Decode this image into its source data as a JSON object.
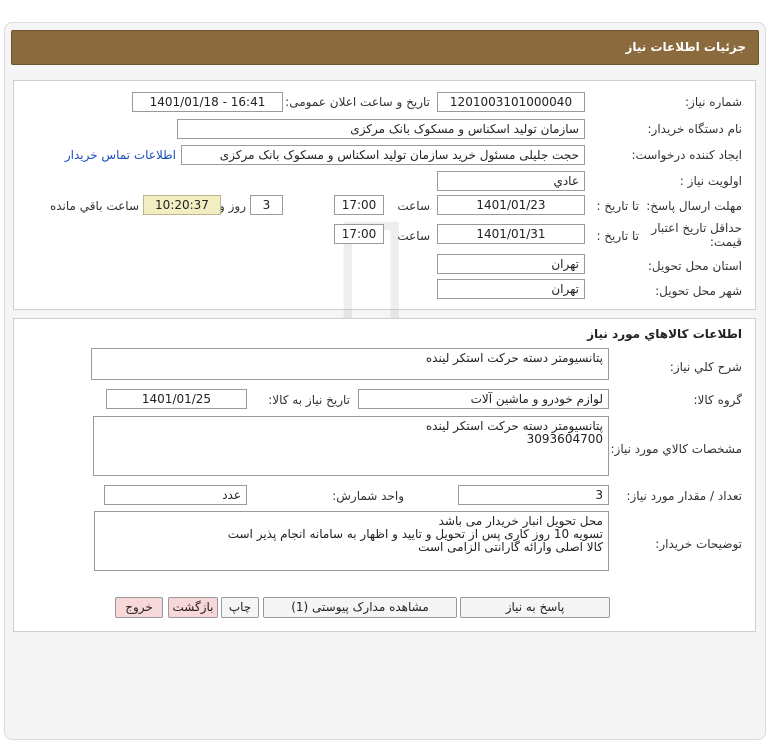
{
  "header": {
    "title": "جزئیات اطلاعات نیاز"
  },
  "need_info": {
    "need_number_label": "شماره نیاز:",
    "need_number": "1201003101000040",
    "announce_label": "تاریخ و ساعت اعلان عمومی:",
    "announce_value": "1401/01/18 - 16:41",
    "buyer_org_label": "نام دستگاه خریدار:",
    "buyer_org": "سازمان تولید اسکناس و مسکوک بانک مرکزی",
    "requester_label": "ایجاد کننده درخواست:",
    "requester": "حجت جلیلی مسئول خرید سازمان تولید اسکناس و مسکوک بانک مرکزی",
    "contact_link": "اطلاعات تماس خریدار",
    "priority_label": "اولویت نیاز :",
    "priority": "عادي",
    "reply_deadline_label": "مهلت ارسال پاسخ:",
    "to_date_label": "تا تاریخ :",
    "reply_date": "1401/01/23",
    "time_label": "ساعت",
    "reply_time": "17:00",
    "days_value": "3",
    "days_label": "روز و",
    "remaining_time": "10:20:37",
    "remaining_label": "ساعت باقي مانده",
    "validity_label_1": "حداقل تاریخ اعتبار",
    "validity_label_2": "قیمت:",
    "validity_to_label": "تا تاریخ :",
    "validity_date": "1401/01/31",
    "validity_time_label": "ساعت",
    "validity_time": "17:00",
    "province_label": "استان محل تحویل:",
    "province": "تهران",
    "city_label": "شهر محل تحویل:",
    "city": "تهران"
  },
  "goods": {
    "section_title": "اطلاعات کالاهاي مورد نياز",
    "summary_label": "شرح کلي نياز:",
    "summary": "پتانسیومتر دسته حرکت استکر لینده",
    "group_label": "گروه کالا:",
    "group": "لوازم خودرو و ماشین آلات",
    "need_date_label": "تاریخ نیاز به کالا:",
    "need_date": "1401/01/25",
    "spec_label": "مشخصات کالاي مورد نياز:",
    "spec_line1": "پتانسیومتر دسته حرکت استکر لینده",
    "spec_line2": "3093604700",
    "qty_label": "تعداد / مقدار مورد نیاز:",
    "qty": "3",
    "unit_label": "واحد شمارش:",
    "unit": "عدد",
    "desc_label": "توضیحات خریدار:",
    "desc_line1": "محل تحویل انبار خریدار می باشد",
    "desc_line2": "تسویه 10 روز کاری پس از تحویل و تایید و اظهار به سامانه انجام پذیر است",
    "desc_line3": "کالا اصلی وارائه گارانتی الزامی است"
  },
  "buttons": {
    "reply": "پاسخ به نیاز",
    "view_docs": "مشاهده مدارک پیوستی (1)",
    "print": "چاپ",
    "back": "بازگشت",
    "exit": "خروج"
  }
}
